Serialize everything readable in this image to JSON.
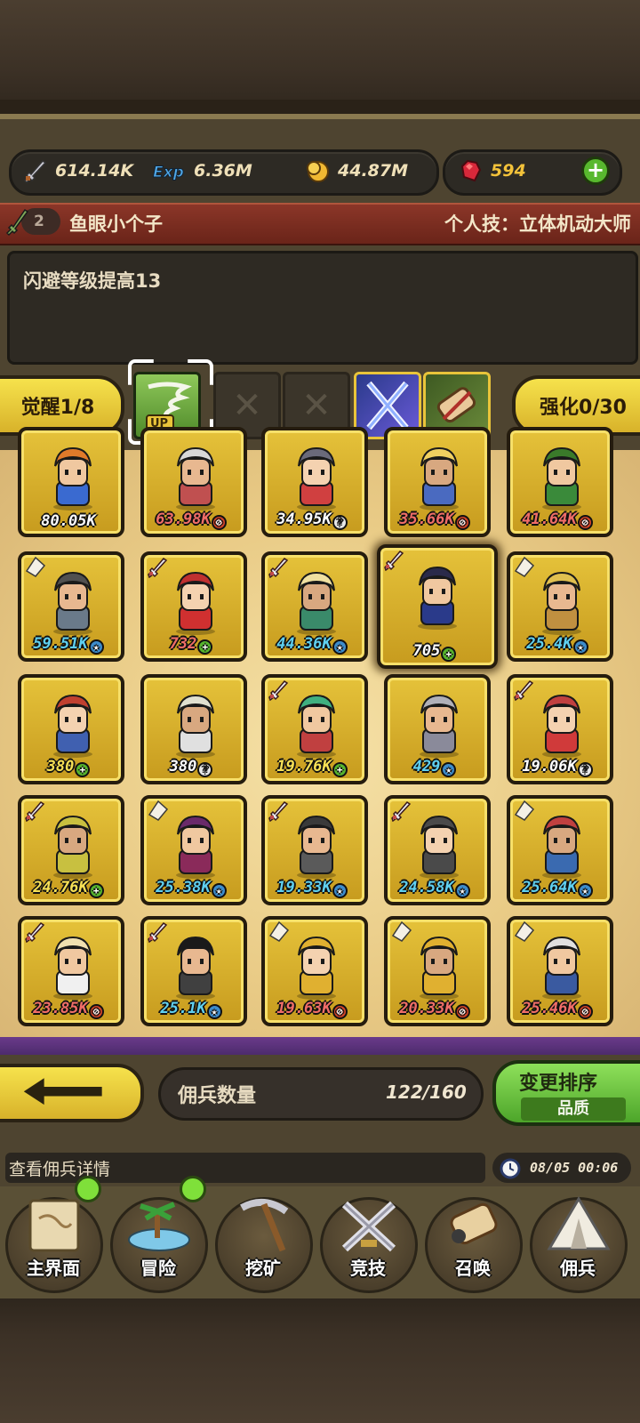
{
  "resources": {
    "attack": "614.14K",
    "exp": "6.36M",
    "gold": "44.87M",
    "gems": "594"
  },
  "hero": {
    "level": "2",
    "name": "鱼眼小个子",
    "personal_skill": "个人技：立体机动大师",
    "description": "闪避等级提高13"
  },
  "tabs": {
    "awaken": "觉醒1/8",
    "enhance": "强化0/30"
  },
  "mercenaries": [
    {
      "power": "80.05K",
      "mark": "none",
      "color": "white",
      "weapon": "none"
    },
    {
      "power": "63.98K",
      "mark": "no",
      "color": "red",
      "weapon": "none"
    },
    {
      "power": "34.95K",
      "mark": "q",
      "color": "white",
      "weapon": "none"
    },
    {
      "power": "35.66K",
      "mark": "no",
      "color": "red",
      "weapon": "none"
    },
    {
      "power": "41.64K",
      "mark": "no",
      "color": "red",
      "weapon": "none"
    },
    {
      "power": "59.51K",
      "mark": "star",
      "color": "blue",
      "weapon": "scroll"
    },
    {
      "power": "732",
      "mark": "plus",
      "color": "red",
      "weapon": "sword"
    },
    {
      "power": "44.36K",
      "mark": "star",
      "color": "blue",
      "weapon": "sword"
    },
    {
      "power": "705",
      "mark": "plus",
      "color": "white",
      "weapon": "sword"
    },
    {
      "power": "25.4K",
      "mark": "star",
      "color": "blue",
      "weapon": "scroll"
    },
    {
      "power": "380",
      "mark": "plus",
      "color": "yellow",
      "weapon": "none"
    },
    {
      "power": "380",
      "mark": "q",
      "color": "white",
      "weapon": "none"
    },
    {
      "power": "19.76K",
      "mark": "plus",
      "color": "yellow",
      "weapon": "sword"
    },
    {
      "power": "429",
      "mark": "star",
      "color": "blue",
      "weapon": "none"
    },
    {
      "power": "19.06K",
      "mark": "q",
      "color": "white",
      "weapon": "sword"
    },
    {
      "power": "24.76K",
      "mark": "plus",
      "color": "yellow",
      "weapon": "sword"
    },
    {
      "power": "25.38K",
      "mark": "star",
      "color": "blue",
      "weapon": "scroll"
    },
    {
      "power": "19.33K",
      "mark": "star",
      "color": "blue",
      "weapon": "sword"
    },
    {
      "power": "24.58K",
      "mark": "star",
      "color": "blue",
      "weapon": "sword"
    },
    {
      "power": "25.64K",
      "mark": "star",
      "color": "blue",
      "weapon": "scroll"
    },
    {
      "power": "23.85K",
      "mark": "no",
      "color": "red",
      "weapon": "sword"
    },
    {
      "power": "25.1K",
      "mark": "star",
      "color": "blue",
      "weapon": "sword"
    },
    {
      "power": "19.63K",
      "mark": "no",
      "color": "red",
      "weapon": "scroll"
    },
    {
      "power": "20.33K",
      "mark": "no",
      "color": "red",
      "weapon": "scroll"
    },
    {
      "power": "25.46K",
      "mark": "no",
      "color": "red",
      "weapon": "scroll"
    }
  ],
  "mercenary_count": {
    "label": "佣兵数量",
    "value": "122/160"
  },
  "sort": {
    "title": "变更排序",
    "current": "品质"
  },
  "info": {
    "text": "查看佣兵详情",
    "time": "08/05 00:06"
  },
  "nav": [
    {
      "label": "主界面",
      "icon": "map-scroll-icon",
      "notify": true
    },
    {
      "label": "冒险",
      "icon": "island-icon",
      "notify": true
    },
    {
      "label": "挖矿",
      "icon": "pickaxe-icon",
      "notify": false
    },
    {
      "label": "竞技",
      "icon": "crossed-swords-icon",
      "notify": false
    },
    {
      "label": "召唤",
      "icon": "summon-scroll-icon",
      "notify": false
    },
    {
      "label": "佣兵",
      "icon": "tent-icon",
      "notify": false
    }
  ],
  "colors": {
    "card_gold": "#d8b22a",
    "power_blue": "#5fd0f0",
    "power_red": "#f06d68",
    "sort_green": "#4da52a",
    "name_band": "#8b3628"
  }
}
